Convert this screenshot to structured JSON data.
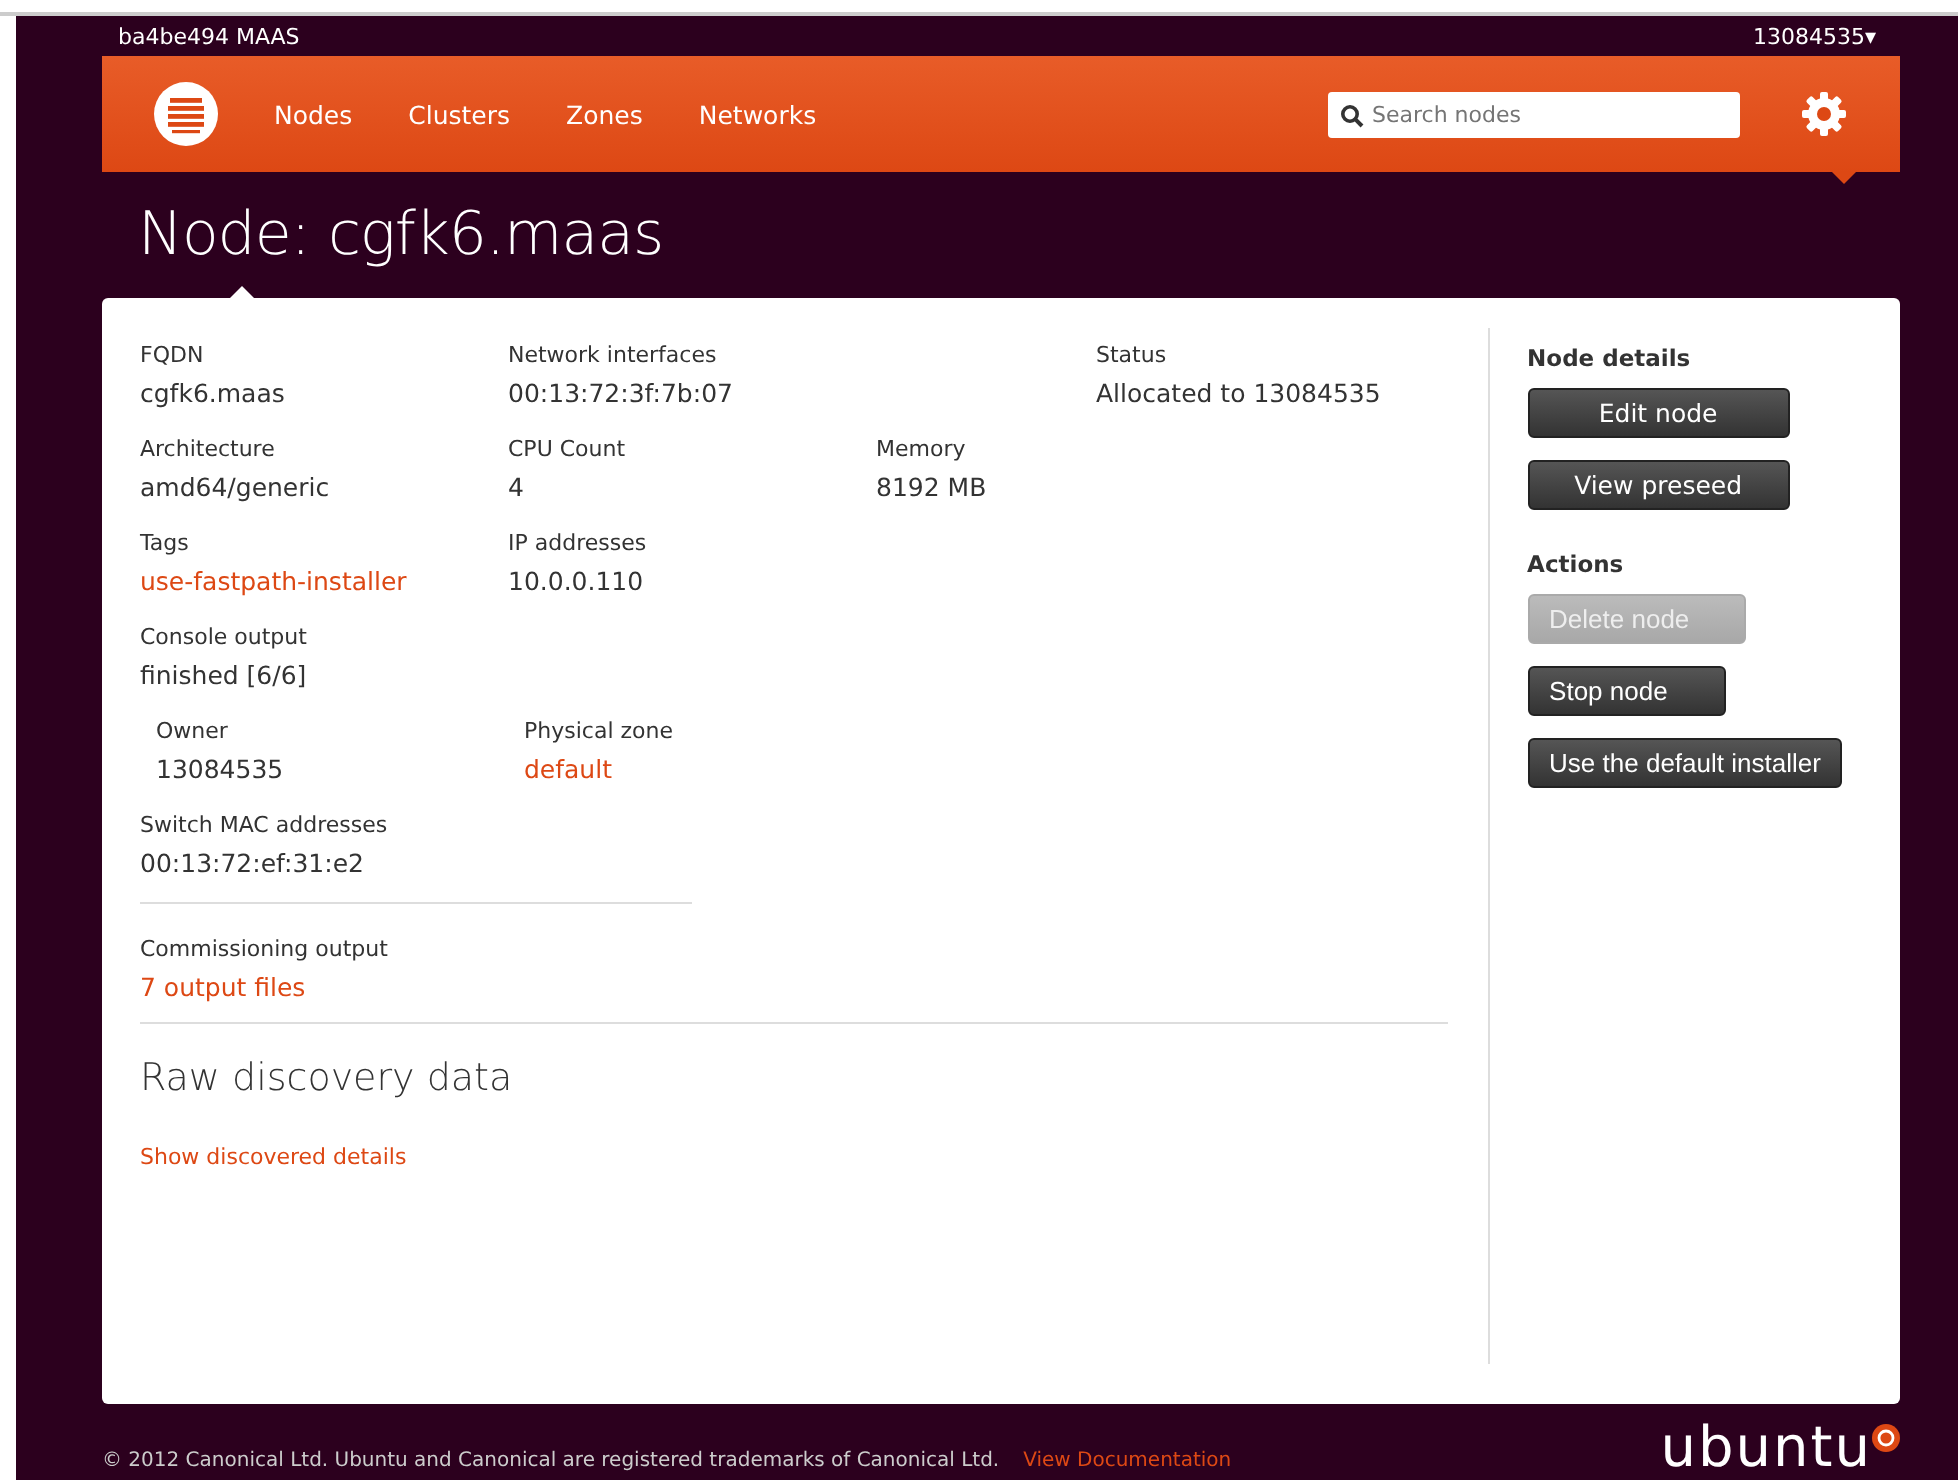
{
  "top_bar": {
    "site": "ba4be494 MAAS",
    "user": "13084535",
    "user_caret": "▾"
  },
  "nav": {
    "items": [
      {
        "label": "Nodes"
      },
      {
        "label": "Clusters"
      },
      {
        "label": "Zones"
      },
      {
        "label": "Networks"
      }
    ],
    "search": {
      "placeholder": "Search nodes"
    }
  },
  "title": "Node: cgfk6.maas",
  "field_rows": [
    [
      {
        "label": "FQDN",
        "value": "cgfk6.maas",
        "kind": "text"
      },
      {
        "label": "Network interfaces",
        "value": "00:13:72:3f:7b:07",
        "kind": "text"
      },
      {
        "label": "Status",
        "value": "Allocated to 13084535",
        "kind": "text"
      }
    ],
    [
      {
        "label": "Architecture",
        "value": "amd64/generic",
        "kind": "text"
      },
      {
        "label": "CPU Count",
        "value": "4",
        "kind": "text"
      },
      {
        "label": "Memory",
        "value": "8192 MB",
        "kind": "text"
      }
    ],
    [
      {
        "label": "Tags",
        "value": "use-fastpath-installer",
        "kind": "link"
      },
      {
        "label": "IP addresses",
        "value": "10.0.0.110",
        "kind": "text"
      }
    ],
    [
      {
        "label": "Console output",
        "value": "finished [6/6]",
        "kind": "text"
      }
    ],
    [
      {
        "label": "Owner",
        "value": "13084535",
        "kind": "text"
      },
      {
        "label": "Physical zone",
        "value": "default",
        "kind": "link"
      }
    ],
    [
      {
        "label": "Switch MAC addresses",
        "value": "00:13:72:ef:31:e2",
        "kind": "text"
      }
    ]
  ],
  "commissioning": {
    "label": "Commissioning output",
    "value": "7 output files"
  },
  "raw_discovery": {
    "heading": "Raw discovery data",
    "link": "Show discovered details"
  },
  "sidebar": [
    {
      "heading": "Node details",
      "buttons": [
        {
          "label": "Edit node",
          "disabled": false
        },
        {
          "label": "View preseed",
          "disabled": false
        }
      ]
    },
    {
      "heading": "Actions",
      "buttons": [
        {
          "label": "Delete node",
          "disabled": true
        },
        {
          "label": "Stop node",
          "disabled": false
        },
        {
          "label": "Use the default installer",
          "disabled": false
        }
      ]
    }
  ],
  "footer": {
    "copyright": "© 2012 Canonical Ltd. Ubuntu and Canonical are registered trademarks of Canonical Ltd.",
    "doc_link": "View Documentation",
    "logo": "ubuntu"
  }
}
